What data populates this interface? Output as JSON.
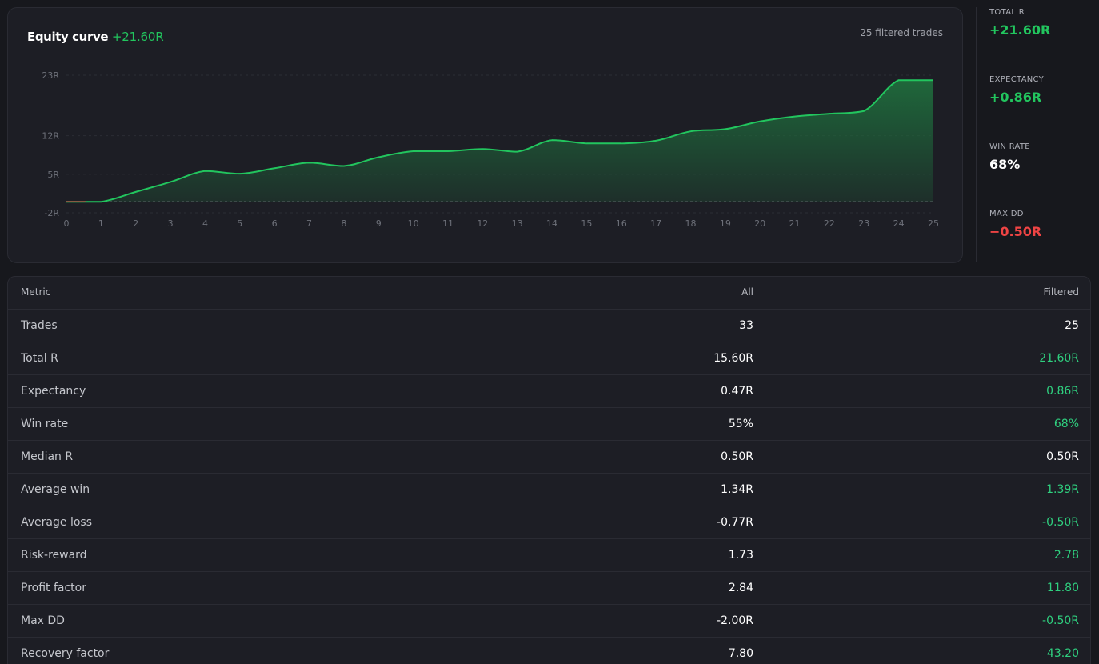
{
  "equity": {
    "title": "Equity curve",
    "title_value": "+21.60R",
    "filtered_note": "25 filtered trades"
  },
  "chart_data": {
    "type": "area",
    "x": [
      0,
      1,
      2,
      3,
      4,
      5,
      6,
      7,
      8,
      9,
      10,
      11,
      12,
      13,
      14,
      15,
      16,
      17,
      18,
      19,
      20,
      21,
      22,
      23,
      24,
      25
    ],
    "y": [
      0,
      0,
      1.8,
      3.6,
      5.6,
      5.1,
      6.1,
      7.1,
      6.5,
      8.1,
      9.2,
      9.2,
      9.6,
      9.1,
      11.2,
      10.6,
      10.6,
      11.1,
      12.8,
      13.2,
      14.6,
      15.5,
      16.0,
      16.5,
      22.1,
      22.1
    ],
    "x_ticks": [
      "0",
      "1",
      "2",
      "3",
      "4",
      "5",
      "6",
      "7",
      "8",
      "9",
      "10",
      "11",
      "12",
      "13",
      "14",
      "15",
      "16",
      "17",
      "18",
      "19",
      "20",
      "21",
      "22",
      "23",
      "24",
      "25"
    ],
    "y_ticks": [
      {
        "value": 23,
        "label": "23R"
      },
      {
        "value": 12,
        "label": "12R"
      },
      {
        "value": 5,
        "label": "5R"
      },
      {
        "value": -2,
        "label": "-2R"
      }
    ],
    "ylim": [
      -2,
      23
    ],
    "xlim": [
      0,
      25
    ],
    "baseline": 0,
    "grid": true,
    "line_color": "#22c55e",
    "fill_color": "#1f6b3c"
  },
  "kpis": [
    {
      "label": "TOTAL R",
      "value": "+21.60R",
      "tone": "pos"
    },
    {
      "label": "EXPECTANCY",
      "value": "+0.86R",
      "tone": "pos"
    },
    {
      "label": "WIN RATE",
      "value": "68%",
      "tone": "neutral"
    },
    {
      "label": "MAX DD",
      "value": "−0.50R",
      "tone": "neg"
    }
  ],
  "table": {
    "headers": {
      "metric": "Metric",
      "all": "All",
      "filtered": "Filtered"
    },
    "rows": [
      {
        "metric": "Trades",
        "all": "33",
        "filtered": "25",
        "filtered_green": false
      },
      {
        "metric": "Total R",
        "all": "15.60R",
        "filtered": "21.60R",
        "filtered_green": true
      },
      {
        "metric": "Expectancy",
        "all": "0.47R",
        "filtered": "0.86R",
        "filtered_green": true
      },
      {
        "metric": "Win rate",
        "all": "55%",
        "filtered": "68%",
        "filtered_green": true
      },
      {
        "metric": "Median R",
        "all": "0.50R",
        "filtered": "0.50R",
        "filtered_green": false
      },
      {
        "metric": "Average win",
        "all": "1.34R",
        "filtered": "1.39R",
        "filtered_green": true
      },
      {
        "metric": "Average loss",
        "all": "-0.77R",
        "filtered": "-0.50R",
        "filtered_green": true
      },
      {
        "metric": "Risk-reward",
        "all": "1.73",
        "filtered": "2.78",
        "filtered_green": true
      },
      {
        "metric": "Profit factor",
        "all": "2.84",
        "filtered": "11.80",
        "filtered_green": true
      },
      {
        "metric": "Max DD",
        "all": "-2.00R",
        "filtered": "-0.50R",
        "filtered_green": true
      },
      {
        "metric": "Recovery factor",
        "all": "7.80",
        "filtered": "43.20",
        "filtered_green": true
      }
    ]
  }
}
